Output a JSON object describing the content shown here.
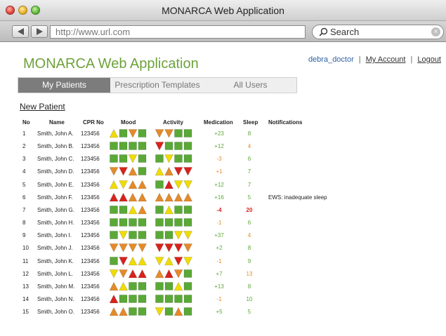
{
  "window": {
    "title": "MONARCA Web Application"
  },
  "browser": {
    "url": "http://www.url.com",
    "search_placeholder": "Search",
    "clear_symbol": "×"
  },
  "app": {
    "title": "MONARCA Web Application"
  },
  "user": {
    "username": "debra_doctor",
    "separator": "|",
    "my_account": "My Account",
    "logout": "Logout"
  },
  "tabs": [
    {
      "label": "My Patients",
      "active": true
    },
    {
      "label": "Prescription Templates",
      "active": false
    },
    {
      "label": "All Users",
      "active": false
    }
  ],
  "new_patient": "New Patient",
  "headers": {
    "no": "No",
    "name": "Name",
    "cpr": "CPR No",
    "mood": "Mood",
    "activity": "Activity",
    "medication": "Medication",
    "sleep": "Sleep",
    "notifications": "Notifications"
  },
  "colors": {
    "green": "#5aa836",
    "yellow": "#f0dc00",
    "orange": "#e58a2a",
    "red": "#d8221c",
    "text_green": "#5aa836",
    "text_orange": "#e58a2a",
    "text_red": "#d8221c"
  },
  "legend": {
    "S": "square",
    "U": "triangle-up",
    "D": "triangle-down",
    "g": "green",
    "y": "yellow",
    "o": "orange",
    "r": "red"
  },
  "patients": [
    {
      "no": "1",
      "name": "Smith, John A.",
      "cpr": "123456",
      "mood": [
        "Uy",
        "Sg",
        "Do",
        "Sg"
      ],
      "activity": [
        "Do",
        "Do",
        "Sg",
        "Sg"
      ],
      "medication": "+23",
      "med_color": "green",
      "sleep": "8",
      "sleep_color": "green",
      "notification": ""
    },
    {
      "no": "2",
      "name": "Smith, John B.",
      "cpr": "123456",
      "mood": [
        "Sg",
        "Sg",
        "Sg",
        "Sg"
      ],
      "activity": [
        "Dr",
        "Sg",
        "Sg",
        "Sg"
      ],
      "medication": "+12",
      "med_color": "green",
      "sleep": "4",
      "sleep_color": "orange",
      "notification": ""
    },
    {
      "no": "3",
      "name": "Smith, John C.",
      "cpr": "123456",
      "mood": [
        "Sg",
        "Sg",
        "Dy",
        "Sg"
      ],
      "activity": [
        "Sg",
        "Dy",
        "Sg",
        "Sg"
      ],
      "medication": "-3",
      "med_color": "orange",
      "sleep": "6",
      "sleep_color": "green",
      "notification": ""
    },
    {
      "no": "4",
      "name": "Smith, John D.",
      "cpr": "123456",
      "mood": [
        "Do",
        "Dr",
        "Uo",
        "Sg"
      ],
      "activity": [
        "Uy",
        "Uo",
        "Dr",
        "Dr"
      ],
      "medication": "+1",
      "med_color": "orange",
      "sleep": "7",
      "sleep_color": "green",
      "notification": ""
    },
    {
      "no": "5",
      "name": "Smith, John E.",
      "cpr": "123456",
      "mood": [
        "Uy",
        "Dy",
        "Uo",
        "Uo"
      ],
      "activity": [
        "Sg",
        "Ur",
        "Dy",
        "Dy"
      ],
      "medication": "+12",
      "med_color": "green",
      "sleep": "7",
      "sleep_color": "green",
      "notification": ""
    },
    {
      "no": "6",
      "name": "Smith, John F.",
      "cpr": "123456",
      "mood": [
        "Ur",
        "Ur",
        "Uo",
        "Uo"
      ],
      "activity": [
        "Uo",
        "Uo",
        "Uo",
        "Uo"
      ],
      "medication": "+16",
      "med_color": "green",
      "sleep": "5",
      "sleep_color": "green",
      "notification": "EWS: inadequate sleep"
    },
    {
      "no": "7",
      "name": "Smith, John G.",
      "cpr": "123456",
      "mood": [
        "Sg",
        "Sg",
        "Uy",
        "Uo"
      ],
      "activity": [
        "Sg",
        "Uy",
        "Sg",
        "Sg"
      ],
      "medication": "-4",
      "med_color": "red",
      "med_bold": true,
      "sleep": "20",
      "sleep_color": "red",
      "sleep_bold": true,
      "notification": ""
    },
    {
      "no": "8",
      "name": "Smith, John H.",
      "cpr": "123456",
      "mood": [
        "Sg",
        "Sg",
        "Sg",
        "Sg"
      ],
      "activity": [
        "Sg",
        "Sg",
        "Sg",
        "Sg"
      ],
      "medication": "-1",
      "med_color": "orange",
      "sleep": "6",
      "sleep_color": "green",
      "notification": ""
    },
    {
      "no": "9",
      "name": "Smith, John I.",
      "cpr": "123456",
      "mood": [
        "Sg",
        "Dy",
        "Sg",
        "Sg"
      ],
      "activity": [
        "Sg",
        "Sg",
        "Dy",
        "Dy"
      ],
      "medication": "+37",
      "med_color": "green",
      "sleep": "4",
      "sleep_color": "orange",
      "notification": ""
    },
    {
      "no": "10",
      "name": "Smith, John J.",
      "cpr": "123456",
      "mood": [
        "Do",
        "Do",
        "Do",
        "Do"
      ],
      "activity": [
        "Dr",
        "Dr",
        "Dr",
        "Do"
      ],
      "medication": "+2",
      "med_color": "green",
      "sleep": "8",
      "sleep_color": "green",
      "notification": ""
    },
    {
      "no": "11",
      "name": "Smith, John K.",
      "cpr": "123456",
      "mood": [
        "Sg",
        "Dr",
        "Uy",
        "Uy"
      ],
      "activity": [
        "Dy",
        "Uy",
        "Dr",
        "Dy"
      ],
      "medication": "-1",
      "med_color": "orange",
      "sleep": "9",
      "sleep_color": "green",
      "notification": ""
    },
    {
      "no": "12",
      "name": "Smith, John L.",
      "cpr": "123456",
      "mood": [
        "Dy",
        "Do",
        "Ur",
        "Ur"
      ],
      "activity": [
        "Uo",
        "Ur",
        "Do",
        "Sg"
      ],
      "medication": "+7",
      "med_color": "green",
      "sleep": "13",
      "sleep_color": "orange",
      "notification": ""
    },
    {
      "no": "13",
      "name": "Smith, John M.",
      "cpr": "123456",
      "mood": [
        "Uo",
        "Uy",
        "Sg",
        "Sg"
      ],
      "activity": [
        "Sg",
        "Sg",
        "Uy",
        "Sg"
      ],
      "medication": "+13",
      "med_color": "green",
      "sleep": "8",
      "sleep_color": "green",
      "notification": ""
    },
    {
      "no": "14",
      "name": "Smith, John N.",
      "cpr": "123456",
      "mood": [
        "Ur",
        "Sg",
        "Sg",
        "Sg"
      ],
      "activity": [
        "Sg",
        "Sg",
        "Sg",
        "Sg"
      ],
      "medication": "-1",
      "med_color": "orange",
      "sleep": "10",
      "sleep_color": "green",
      "notification": ""
    },
    {
      "no": "15",
      "name": "Smith, John O.",
      "cpr": "123456",
      "mood": [
        "Uo",
        "Uo",
        "Sg",
        "Sg"
      ],
      "activity": [
        "Dy",
        "Sg",
        "Uo",
        "Sg"
      ],
      "medication": "+5",
      "med_color": "green",
      "sleep": "5",
      "sleep_color": "green",
      "notification": ""
    }
  ]
}
